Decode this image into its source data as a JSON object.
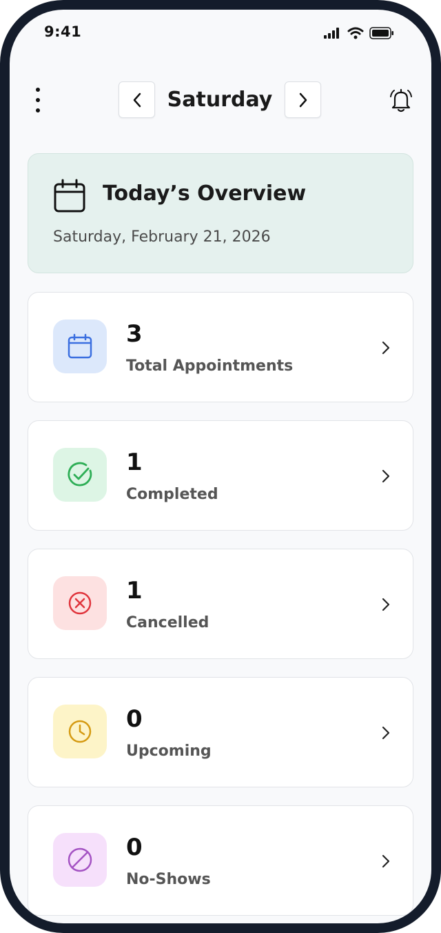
{
  "status_bar": {
    "time": "9:41"
  },
  "header": {
    "day": "Saturday"
  },
  "overview": {
    "title": "Today’s Overview",
    "date": "Saturday, February 21, 2026"
  },
  "stats": [
    {
      "count": "3",
      "label": "Total Appointments",
      "icon": "calendar-icon",
      "color": "#3b6fe0",
      "bg": "#dce8fb"
    },
    {
      "count": "1",
      "label": "Completed",
      "icon": "check-circle-icon",
      "color": "#2eae56",
      "bg": "#ddf5e5"
    },
    {
      "count": "1",
      "label": "Cancelled",
      "icon": "x-circle-icon",
      "color": "#e0343c",
      "bg": "#fde1e1"
    },
    {
      "count": "0",
      "label": "Upcoming",
      "icon": "clock-icon",
      "color": "#d59a12",
      "bg": "#fdf4c8"
    },
    {
      "count": "0",
      "label": "No-Shows",
      "icon": "ban-icon",
      "color": "#a453c3",
      "bg": "#f6e0fb"
    }
  ]
}
